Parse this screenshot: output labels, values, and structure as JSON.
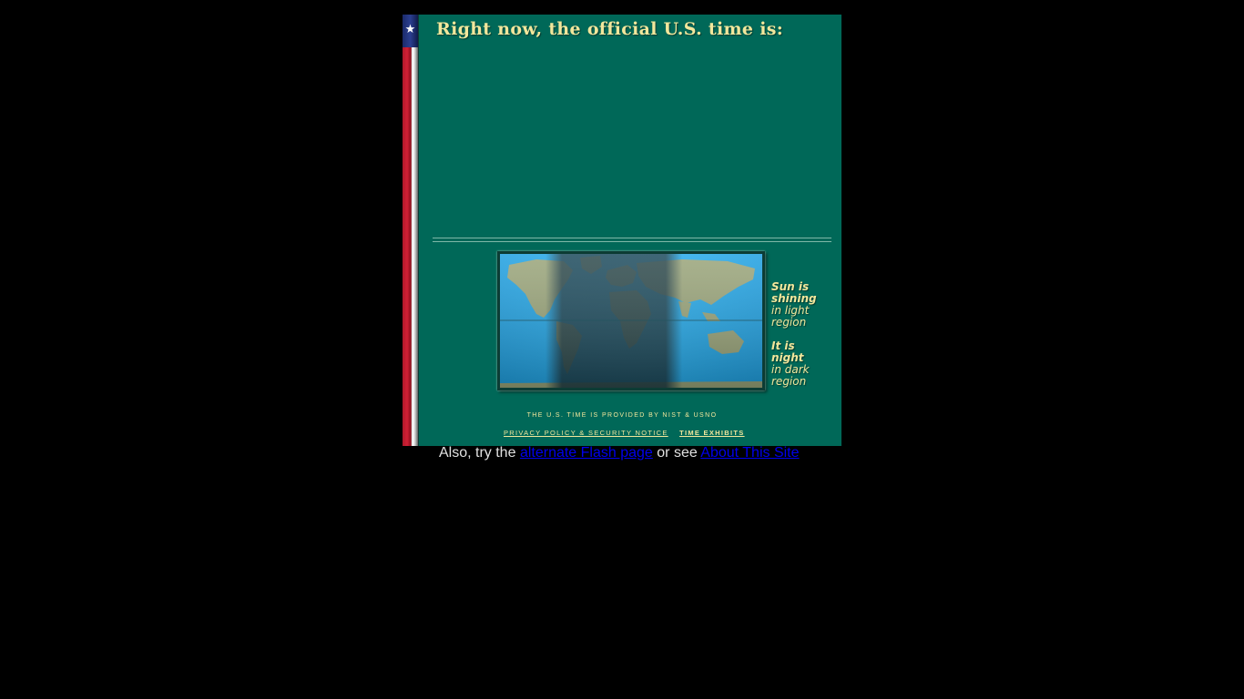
{
  "panel": {
    "title": "Right now, the official U.S. time is:",
    "legend": {
      "light_bold": "Sun is shining",
      "light_text": "in light region",
      "dark_bold": "It is night",
      "dark_text": "in dark region"
    },
    "credit": "The U.S. time is provided by NIST & USNO",
    "privacy_link": "Privacy Policy & Security Notice",
    "exhibits_link": "Time Exhibits"
  },
  "footer": {
    "prefix": "Also, try the",
    "flash_link": "alternate Flash page",
    "middle": "or see",
    "about_link": "About This Site"
  },
  "colors": {
    "page_background": "#000000",
    "panel_background": "#006858",
    "accent_text": "#f2e79c",
    "link_blue": "#0000ee"
  },
  "icons": [
    "star-icon",
    "world-map-icon"
  ]
}
